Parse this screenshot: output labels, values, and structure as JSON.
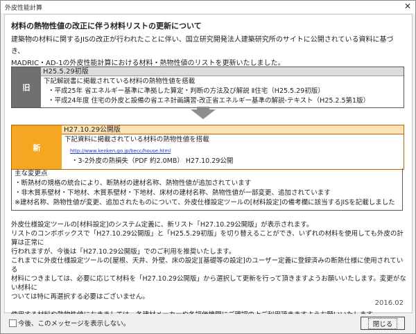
{
  "window": {
    "title": "外皮性能計算",
    "close_glyph": "✕"
  },
  "heading": "材料の熱物性値の改正に伴う材料リストの更新について",
  "intro": [
    "建築物の材料に関するJISの改正が行われたことに伴い、国立研究開発法人建築研究所のサイトに公開されている資料に基づき、",
    "MADRIC・AD-1の外皮性能計算における材料・熱物性値のリストを更新いたしました。"
  ],
  "old": {
    "label": "旧",
    "version": "H25.5.29初版",
    "lines": [
      "下記解説書に掲載されている材料の熱物性値を搭載",
      "・平成25年 省エネルギー基準に準拠した算定・判断の方法及び解説 Ⅱ住宅（H25.5.29初版）",
      "・平成24年度 住宅の外皮と設備の省エネ計画講習-改正省エネルギー基準の解説-テキスト（H25.2.5第1版）"
    ]
  },
  "new": {
    "label": "新",
    "version": "H27.10.29公開版",
    "line1": "下記資料に掲載されている材料の熱物性値を搭載",
    "link": "http://www.kenken.go.jp/becc/house.html",
    "line2": "・3-2外皮の熱損失（PDF 約2.0MB） H27.10.29公開"
  },
  "changes": [
    "主な変更点",
    "・断熱材の規格の統合により、断熱材の建材名称、熱物性値が追加されています",
    "・非木質系壁材・下地材、木質系壁材・下地材、床材の建材名称、熱物性値が一部変更、追加されています",
    "※建材名称、熱物性値が変更、追加されたものについて、外皮仕様設定ツールの[材料設定]の備考欄に該当するJISを記載しました"
  ],
  "body": [
    "外皮仕様設定ツールの[材料設定]のシステム定義に、新リスト「H27.10.29公開版」が表示されます。",
    "リストのコンボボックスで「H27.10.29公開版」と「H25.5.29初版」を切り替えることができ、いずれの材料を使用しても外皮の計算は正常に",
    "行われますが、今後は「H27.10.29公開版」でのご利用を推奨いたします。",
    "これまでに外皮仕様設定ツールの[屋根、天井、外壁、床の設定][基礎等の設定]のユーザー定義に登録済みの断熱仕様に使用されている",
    "材料につきましては、必要に応じて材料を「H27.10.29公開版」から選択して更新を行って頂きますようお願いいたします。変更がない材料に",
    "ついては特に再選択する必要はございません。",
    "",
    "使用する材料や熱物性値におきましては、各建材メーカーや各評価機関にご確認の上ご利用頂きますようお願いいたします。"
  ],
  "date": "2016.02",
  "footer": {
    "checkbox_label": "今後、このメッセージを表示しない。",
    "close_label": "閉じる"
  }
}
